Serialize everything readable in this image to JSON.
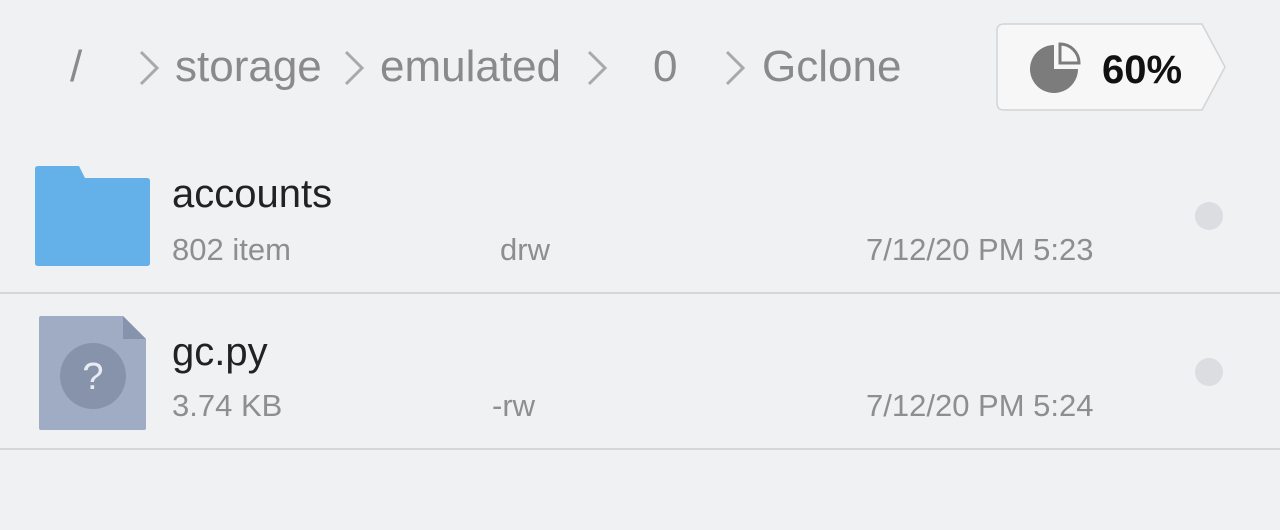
{
  "breadcrumb": {
    "items": [
      {
        "label": "/"
      },
      {
        "label": "storage"
      },
      {
        "label": "emulated"
      },
      {
        "label": "0"
      },
      {
        "label": "Gclone"
      }
    ]
  },
  "storage": {
    "percent_label": "60%",
    "used_fraction": 0.6,
    "icon": "pie-chart-icon"
  },
  "files": [
    {
      "name": "accounts",
      "type": "folder",
      "icon": "folder-icon",
      "size": "802 item",
      "permissions": "drw",
      "modified": "7/12/20 PM 5:23"
    },
    {
      "name": "gc.py",
      "type": "unknown-file",
      "icon": "unknown-file-icon",
      "size": "3.74 KB",
      "permissions": "-rw",
      "modified": "7/12/20 PM 5:24"
    }
  ],
  "colors": {
    "background": "#f0f1f3",
    "folder": "#64b0e8",
    "unknown_file": "#a0acc4",
    "divider": "#d6d7d9"
  }
}
